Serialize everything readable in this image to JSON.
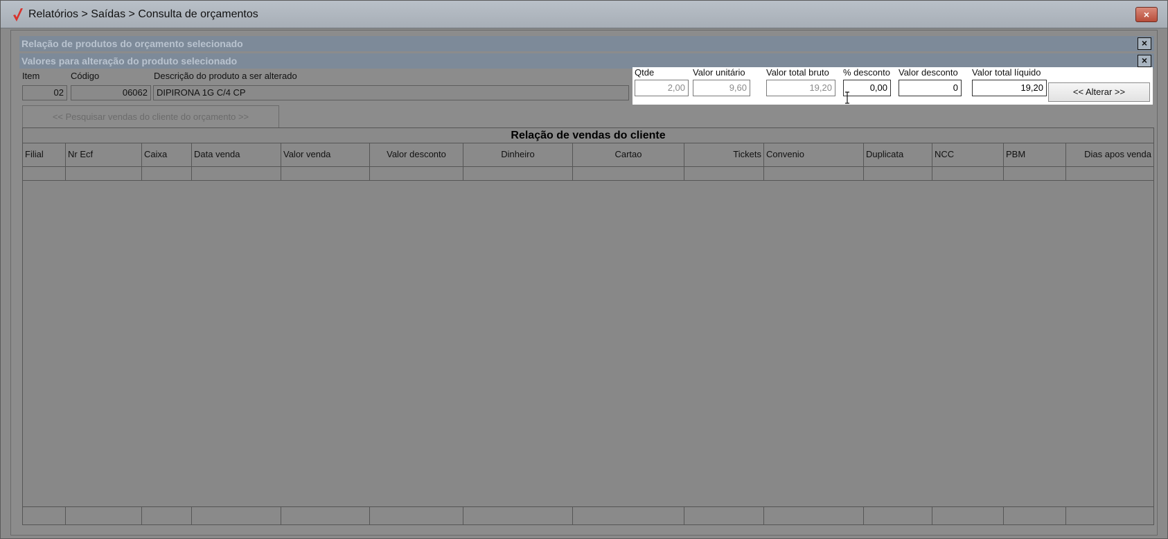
{
  "window": {
    "title": "Relatórios > Saídas > Consulta de orçamentos",
    "close_label": "×",
    "accent_color": "#d9322c"
  },
  "panel1": {
    "title": "Relação de produtos do orçamento selecionado",
    "close_label": "×"
  },
  "panel2": {
    "title": "Valores para alteração do produto selecionado",
    "close_label": "×"
  },
  "product": {
    "item_label": "Item",
    "item_value": "02",
    "code_label": "Código",
    "code_value": "06062",
    "desc_label": "Descrição do produto a ser alterado",
    "desc_value": "DIPIRONA 1G C/4 CP"
  },
  "values": {
    "qtde_label": "Qtde",
    "qtde_value": "2,00",
    "unit_label": "Valor unitário",
    "unit_value": "9,60",
    "gross_label": "Valor total bruto",
    "gross_value": "19,20",
    "disc_pct_label": "% desconto",
    "disc_pct_value": "0,00",
    "disc_val_label": "Valor desconto",
    "disc_val_value": "0",
    "net_label": "Valor total líquido",
    "net_value": "19,20"
  },
  "buttons": {
    "alterar": "<< Alterar >>",
    "pesquisar": "<< Pesquisar vendas do cliente do orçamento >>"
  },
  "sales_grid": {
    "title": "Relação de vendas do cliente",
    "columns": [
      "Filial",
      "Nr Ecf",
      "Caixa",
      "Data venda",
      "Valor venda",
      "Valor desconto",
      "Dinheiro",
      "Cartao",
      "Tickets",
      "Convenio",
      "Duplicata",
      "NCC",
      "PBM",
      "Dias apos venda"
    ]
  }
}
